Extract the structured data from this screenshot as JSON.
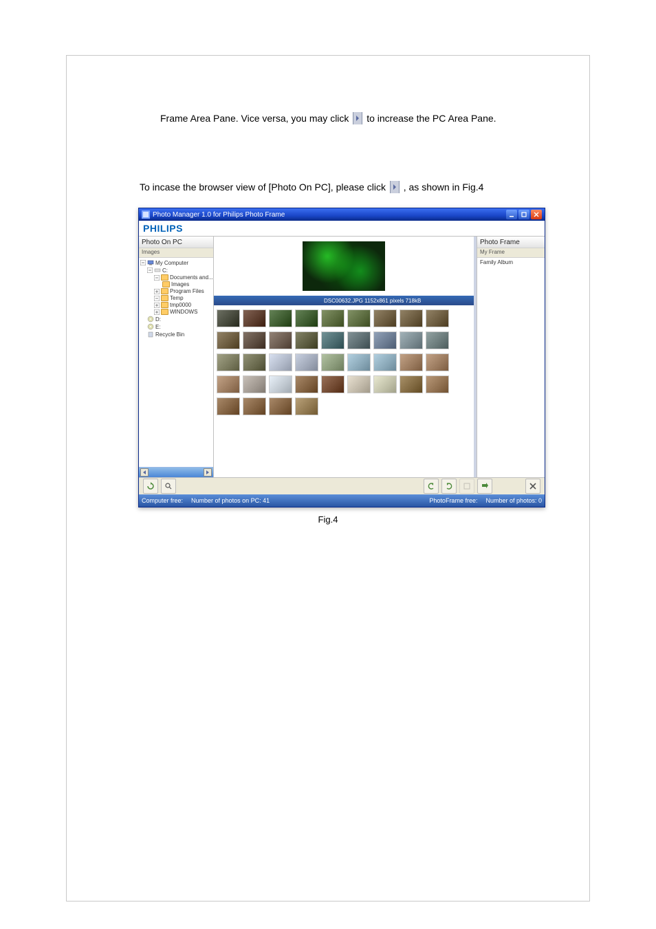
{
  "paragraph1_before": "Frame Area Pane. Vice versa, you may click ",
  "paragraph1_after": " to increase the PC Area Pane.",
  "paragraph2_before": "To incase the browser view of [Photo On PC], please click",
  "paragraph2_after": ", as shown in Fig.4",
  "app": {
    "titlebar": "Photo Manager 1.0 for Philips Photo Frame",
    "brand": "PHILIPS",
    "left_panel": {
      "title": "Photo On PC",
      "sub": "Images",
      "tree": {
        "root": "My Computer",
        "c_drive": "C:",
        "documents": "Documents and...",
        "images": "Images",
        "program_files": "Program Files",
        "temp": "Temp",
        "tmp0000": "tmp0000",
        "windows": "WINDOWS",
        "d": "D:",
        "e": "E:",
        "recycle": "Recycle Bin"
      }
    },
    "center_panel": {
      "status": "DSC00632.JPG   1152x861 pixels   718kB"
    },
    "right_panel": {
      "title": "Photo Frame",
      "sub": "My Frame",
      "tree_root": "Family     Album"
    },
    "toolbar": {
      "refresh": "⟳",
      "find": "🔍",
      "rotate_l": "↶",
      "rotate_r": "↷",
      "crop": "▭",
      "send": "⇨",
      "close": "✕"
    },
    "statusbar": {
      "computer": "Computer free:",
      "num_pc": "Number of photos on PC: 41",
      "frame_conn": "PhotoFrame free:",
      "num_frame": "Number of photos: 0"
    }
  },
  "figure_caption": "Fig.4",
  "thumbs": [
    "#44473a",
    "#5a3b2c",
    "#3c5a2e",
    "#3c5a2e",
    "#5a6a3e",
    "#5a6a3e",
    "#6a5a3e",
    "#6a5a3e",
    "#6a5a3e",
    "#6a5a3e",
    "#5a4a3e",
    "#6a5a4e",
    "#5a5a3e",
    "#4a6a6e",
    "#5a6a6e",
    "#6a7a90",
    "#7a8a90",
    "#6a7a7a",
    "#7a7a5e",
    "#6a6a4e",
    "#b0b8c8",
    "#a0a8b8",
    "#8a9a7a",
    "#8aa8b8",
    "#8aa8b8",
    "#9a7a5e",
    "#9a7a5e",
    "#9a7a5e",
    "#a09890",
    "#c0c8d0",
    "#806040",
    "#704830",
    "#c0b8a8",
    "#c0c0a8",
    "#806840",
    "#907050",
    "#806040",
    "#806040",
    "#806040",
    "#907850"
  ]
}
